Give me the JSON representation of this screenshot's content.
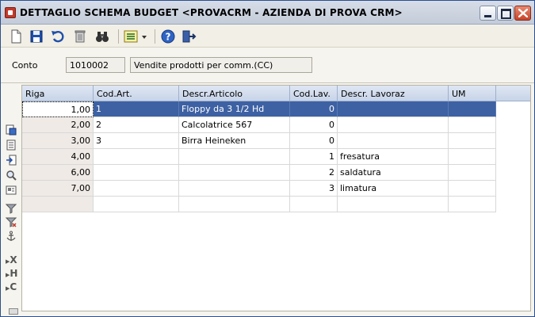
{
  "window": {
    "title": "DETTAGLIO SCHEMA BUDGET <PROVACRM - AZIENDA DI PROVA CRM>"
  },
  "toolbar": {
    "buttons": [
      {
        "name": "new-document-icon"
      },
      {
        "name": "save-icon"
      },
      {
        "name": "undo-icon"
      },
      {
        "name": "delete-icon"
      },
      {
        "name": "binoculars-icon"
      },
      {
        "name": "list-options-icon"
      },
      {
        "name": "help-icon"
      },
      {
        "name": "exit-icon"
      }
    ]
  },
  "form": {
    "conto_label": "Conto",
    "conto_code": "1010002",
    "conto_description": "Vendite prodotti per comm.(CC)"
  },
  "grid": {
    "columns": [
      "Riga",
      "Cod.Art.",
      "Descr.Articolo",
      "Cod.Lav.",
      "Descr. Lavoraz",
      "UM"
    ],
    "rows": [
      {
        "riga": "1,00",
        "cod_art": "1",
        "descr_articolo": "Floppy da 3 1/2 Hd",
        "cod_lav": "0",
        "descr_lavoraz": "",
        "um": "",
        "selected": true
      },
      {
        "riga": "2,00",
        "cod_art": "2",
        "descr_articolo": "Calcolatrice 567",
        "cod_lav": "0",
        "descr_lavoraz": "",
        "um": ""
      },
      {
        "riga": "3,00",
        "cod_art": "3",
        "descr_articolo": "Birra Heineken",
        "cod_lav": "0",
        "descr_lavoraz": "",
        "um": ""
      },
      {
        "riga": "4,00",
        "cod_art": "",
        "descr_articolo": "",
        "cod_lav": "1",
        "descr_lavoraz": "fresatura",
        "um": ""
      },
      {
        "riga": "6,00",
        "cod_art": "",
        "descr_articolo": "",
        "cod_lav": "2",
        "descr_lavoraz": "saldatura",
        "um": ""
      },
      {
        "riga": "7,00",
        "cod_art": "",
        "descr_articolo": "",
        "cod_lav": "3",
        "descr_lavoraz": "limatura",
        "um": ""
      },
      {
        "riga": "",
        "cod_art": "",
        "descr_articolo": "",
        "cod_lav": "",
        "descr_lavoraz": "",
        "um": ""
      }
    ]
  },
  "side_tools": {
    "items": [
      {
        "name": "insert-row-icon"
      },
      {
        "name": "list-icon"
      },
      {
        "name": "import-icon"
      },
      {
        "name": "zoom-icon"
      },
      {
        "name": "card-icon"
      },
      {
        "name": "filter-icon"
      },
      {
        "name": "filter-remove-icon"
      },
      {
        "name": "anchor-icon"
      }
    ],
    "letter_x": "X",
    "letter_h": "H",
    "letter_c": "C"
  }
}
